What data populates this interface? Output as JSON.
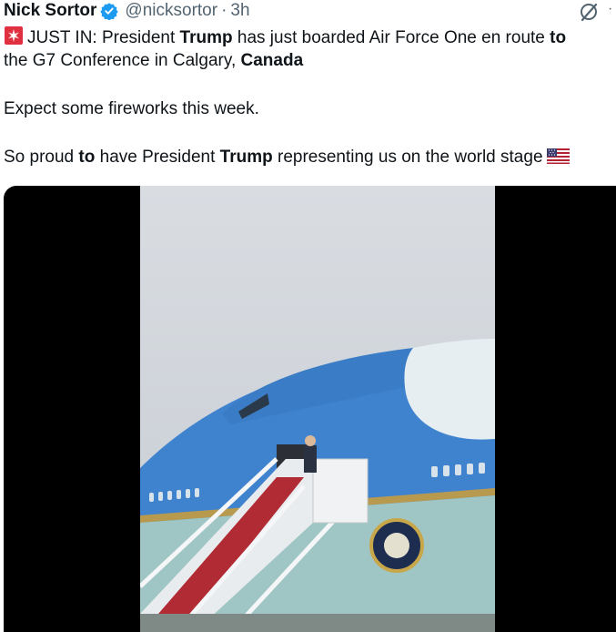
{
  "author": {
    "name": "Nick Sortor",
    "handle": "@nicksortor",
    "separator": "·",
    "time": "3h"
  },
  "tweet": {
    "line1": [
      {
        "t": "JUST IN: President ",
        "b": false
      },
      {
        "t": "Trump",
        "b": true
      },
      {
        "t": " has just boarded Air Force One en route ",
        "b": false
      },
      {
        "t": "to",
        "b": true
      }
    ],
    "line2": [
      {
        "t": "the G7 Conference in Calgary, ",
        "b": false
      },
      {
        "t": "Canada",
        "b": true
      }
    ],
    "line3": [
      {
        "t": "Expect some fireworks this week.",
        "b": false
      }
    ],
    "line4": [
      {
        "t": "So proud ",
        "b": false
      },
      {
        "t": "to",
        "b": true
      },
      {
        "t": " have President ",
        "b": false
      },
      {
        "t": "Trump",
        "b": true
      },
      {
        "t": " representing us on the world stage",
        "b": false
      }
    ]
  },
  "icons": {
    "verified": "verified-badge-icon",
    "grok": "grok-icon",
    "more": "more-icon",
    "siren": "rotating-light-emoji",
    "flag": "us-flag-emoji"
  },
  "colors": {
    "text": "#0f1419",
    "muted": "#536471",
    "verified": "#1d9bf0",
    "aircraft_top": "#3f83cf",
    "aircraft_bottom": "#9fc6c4"
  }
}
